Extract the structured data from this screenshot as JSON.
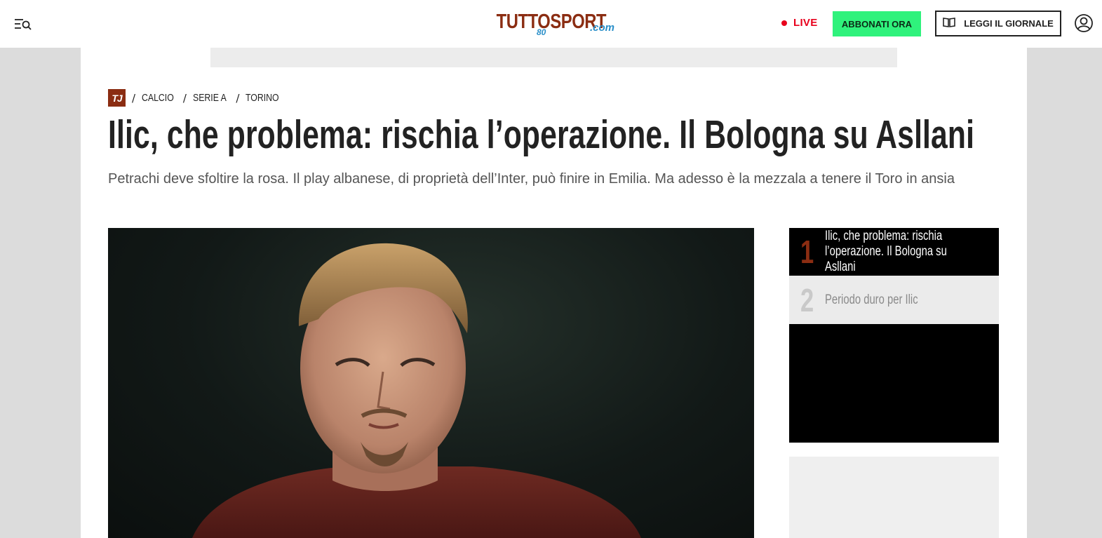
{
  "header": {
    "logo_text": "TUTTOSPORT",
    "logo_suffix": ".com",
    "logo_badge": "80",
    "live_label": "LIVE",
    "subscribe_label": "ABBONATI ORA",
    "read_label": "LEGGI IL GIORNALE",
    "icons": {
      "menu": "menu-search-icon",
      "book": "book-icon",
      "user": "user-icon"
    },
    "colors": {
      "live": "#e8001c",
      "subscribe": "#2ff27c",
      "brand": "#8b2d12"
    }
  },
  "breadcrumb": {
    "logo_text": "TJ",
    "items": [
      "CALCIO",
      "SERIE A",
      "TORINO"
    ]
  },
  "article": {
    "title": "Ilic, che problema: rischia l’operazione. Il Bologna su Asllani",
    "subtitle": "Petrachi deve sfoltire la rosa. Il play albanese, di proprietà dell’Inter, può finire in Emilia. Ma adesso è la mezzala a tenere il Toro in ansia"
  },
  "related": [
    {
      "number": "1",
      "text": "Ilic, che problema: rischia l’operazione. Il Bologna su Asllani",
      "active": true
    },
    {
      "number": "2",
      "text": "Periodo duro per Ilic",
      "active": false
    }
  ]
}
